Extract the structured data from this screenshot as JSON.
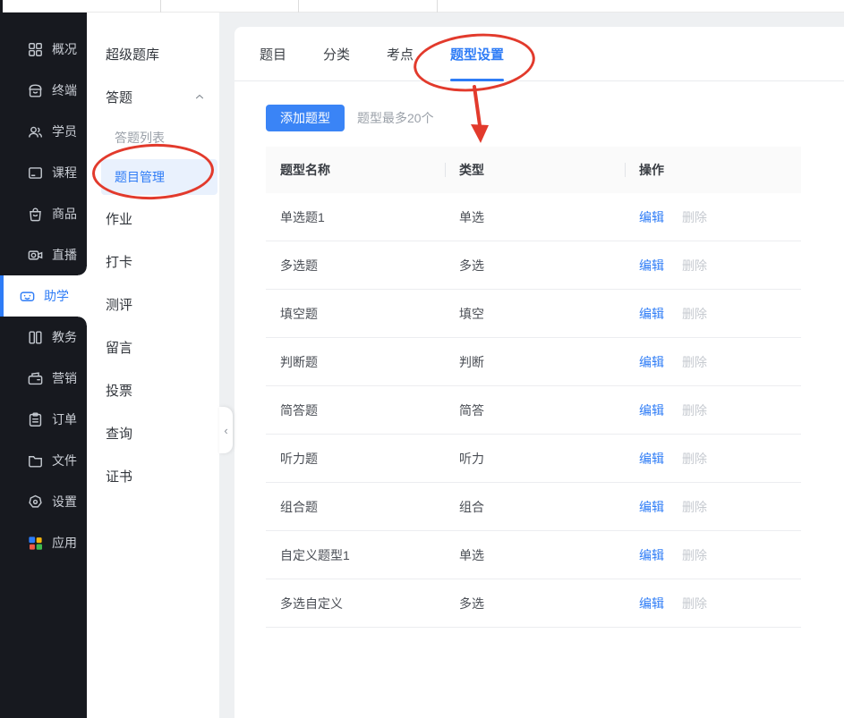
{
  "colors": {
    "accent": "#2e7cf6",
    "annotation": "#e23a2c",
    "sidebar_bg": "#17191f"
  },
  "primary_nav": {
    "items": [
      {
        "label": "概况",
        "icon": "overview-grid-icon",
        "active": false
      },
      {
        "label": "终端",
        "icon": "storefront-icon",
        "active": false
      },
      {
        "label": "学员",
        "icon": "students-icon",
        "active": false
      },
      {
        "label": "课程",
        "icon": "course-icon",
        "active": false
      },
      {
        "label": "商品",
        "icon": "goods-bag-icon",
        "active": false
      },
      {
        "label": "直播",
        "icon": "live-camera-icon",
        "active": false
      },
      {
        "label": "助学",
        "icon": "study-aid-icon",
        "active": true
      },
      {
        "label": "教务",
        "icon": "academic-icon",
        "active": false
      },
      {
        "label": "营销",
        "icon": "marketing-icon",
        "active": false
      },
      {
        "label": "订单",
        "icon": "orders-icon",
        "active": false
      },
      {
        "label": "文件",
        "icon": "files-folder-icon",
        "active": false
      },
      {
        "label": "设置",
        "icon": "settings-icon",
        "active": false
      },
      {
        "label": "应用",
        "icon": "apps-icon",
        "active": false
      }
    ]
  },
  "secondary_nav": {
    "items": [
      {
        "label": "超级题库"
      },
      {
        "label": "答题",
        "chevron": true
      },
      {
        "label": "答题列表",
        "child": true,
        "muted": true
      },
      {
        "label": "题目管理",
        "child": true,
        "active": true
      },
      {
        "label": "作业"
      },
      {
        "label": "打卡"
      },
      {
        "label": "测评"
      },
      {
        "label": "留言"
      },
      {
        "label": "投票"
      },
      {
        "label": "查询"
      },
      {
        "label": "证书"
      }
    ]
  },
  "content": {
    "tabs": {
      "items": [
        {
          "label": "题目",
          "active": false
        },
        {
          "label": "分类",
          "active": false
        },
        {
          "label": "考点",
          "active": false
        },
        {
          "label": "题型设置",
          "active": true
        }
      ]
    },
    "toolbar": {
      "add_button_label": "添加题型",
      "hint": "题型最多20个"
    },
    "table": {
      "headers": {
        "name": "题型名称",
        "type": "类型",
        "actions": "操作"
      },
      "action_labels": {
        "edit": "编辑",
        "delete": "删除"
      },
      "rows": [
        {
          "name": "单选题1",
          "type": "单选"
        },
        {
          "name": "多选题",
          "type": "多选"
        },
        {
          "name": "填空题",
          "type": "填空"
        },
        {
          "name": "判断题",
          "type": "判断"
        },
        {
          "name": "简答题",
          "type": "简答"
        },
        {
          "name": "听力题",
          "type": "听力"
        },
        {
          "name": "组合题",
          "type": "组合"
        },
        {
          "name": "自定义题型1",
          "type": "单选"
        },
        {
          "name": "多选自定义",
          "type": "多选"
        }
      ]
    }
  },
  "collapse_handle": {
    "glyph": "‹"
  }
}
